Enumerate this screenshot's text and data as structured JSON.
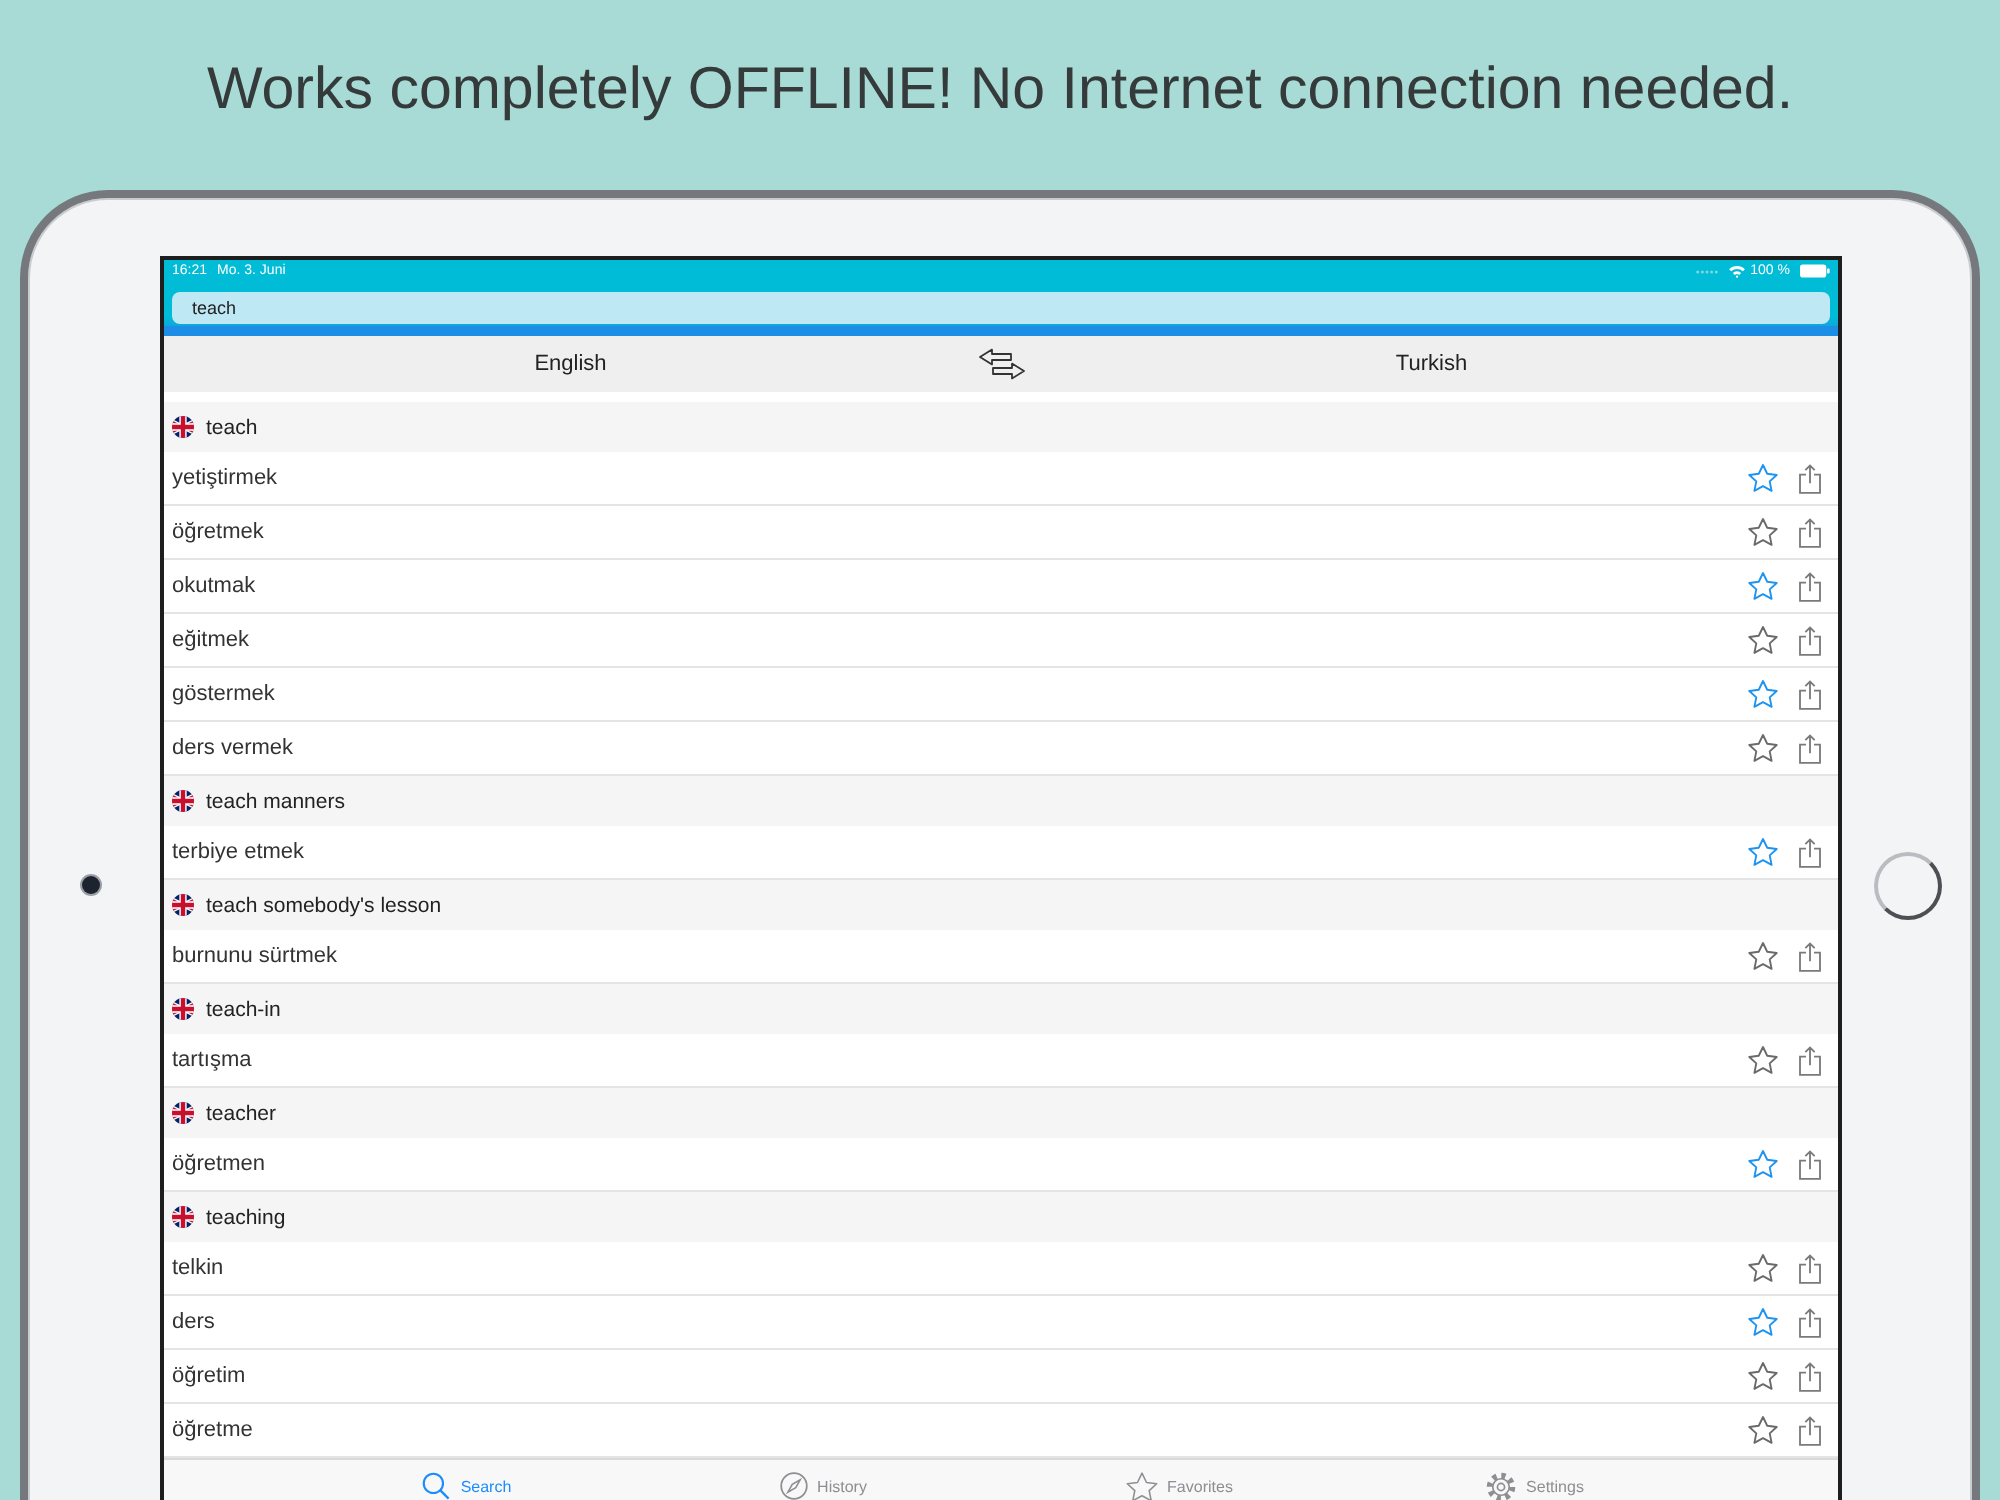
{
  "headline": "Works completely OFFLINE! No Internet connection needed.",
  "status_bar": {
    "time": "16:21",
    "date": "Mo. 3. Juni",
    "battery": "100 %"
  },
  "search": {
    "value": "teach"
  },
  "languages": {
    "source": "English",
    "target": "Turkish"
  },
  "results": [
    {
      "term": "teach",
      "translations": [
        {
          "text": "yetiştirmek",
          "favorite": true
        },
        {
          "text": "öğretmek",
          "favorite": false
        },
        {
          "text": "okutmak",
          "favorite": true
        },
        {
          "text": "eğitmek",
          "favorite": false
        },
        {
          "text": "göstermek",
          "favorite": true
        },
        {
          "text": "ders vermek",
          "favorite": false
        }
      ]
    },
    {
      "term": "teach manners",
      "translations": [
        {
          "text": "terbiye etmek",
          "favorite": true
        }
      ]
    },
    {
      "term": "teach somebody's lesson",
      "translations": [
        {
          "text": "burnunu sürtmek",
          "favorite": false
        }
      ]
    },
    {
      "term": "teach-in",
      "translations": [
        {
          "text": "tartışma",
          "favorite": false
        }
      ]
    },
    {
      "term": "teacher",
      "translations": [
        {
          "text": "öğretmen",
          "favorite": true
        }
      ]
    },
    {
      "term": "teaching",
      "translations": [
        {
          "text": "telkin",
          "favorite": false
        },
        {
          "text": "ders",
          "favorite": true
        },
        {
          "text": "öğretim",
          "favorite": false
        },
        {
          "text": "öğretme",
          "favorite": false
        }
      ]
    }
  ],
  "tab_bar": [
    {
      "label": "Search",
      "kind": "search",
      "selected": true
    },
    {
      "label": "History",
      "kind": "history",
      "selected": false
    },
    {
      "label": "Favorites",
      "kind": "favorites",
      "selected": false
    },
    {
      "label": "Settings",
      "kind": "settings",
      "selected": false
    }
  ]
}
